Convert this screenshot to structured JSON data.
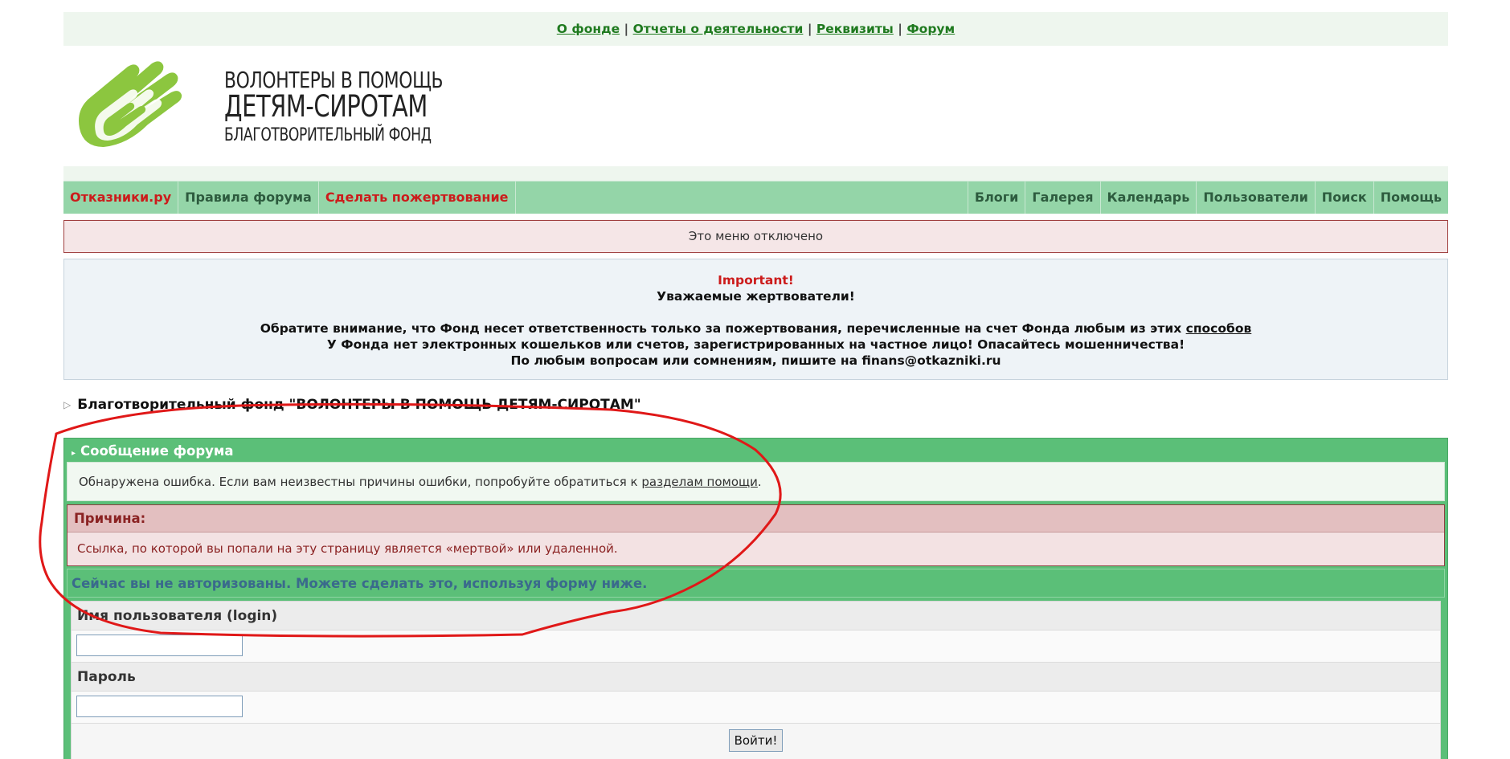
{
  "toplinks": {
    "items": [
      "О фонде",
      "Отчеты о деятельности",
      "Реквизиты",
      "Форум"
    ],
    "separator": "|"
  },
  "logo": {
    "line1": "ВОЛОНТЕРЫ В ПОМОЩЬ",
    "line2": "ДЕТЯМ-СИРОТАМ",
    "line3": "БЛАГОТВОРИТЕЛЬНЫЙ ФОНД"
  },
  "nav": {
    "left": [
      {
        "label": "Отказники.ру",
        "color": "#cc1b1b"
      },
      {
        "label": "Правила форума",
        "color": "#2d5b3e"
      },
      {
        "label": "Сделать пожертвование",
        "color": "#cc1b1b"
      }
    ],
    "right": [
      "Блоги",
      "Галерея",
      "Календарь",
      "Пользователи",
      "Поиск",
      "Помощь"
    ]
  },
  "disabled_menu": "Это меню отключено",
  "notice": {
    "important": "Important!",
    "greeting": "Уважаемые жертвователи!",
    "line1_prefix": "Обратите внимание, что Фонд несет ответственность только за пожертвования, перечисленные на счет Фонда любым из этих",
    "line1_link": "способов",
    "line2": "У Фонда нет электронных кошельков или счетов, зарегистрированных на частное лицо! Опасайтесь мошенничества!",
    "line3": "По любым вопросам или сомнениям, пишите на finans@otkazniki.ru"
  },
  "breadcrumb": "Благотворительный фонд \"ВОЛОНТЕРЫ В ПОМОЩЬ ДЕТЯМ-СИРОТАМ\"",
  "message": {
    "title": "Сообщение форума",
    "body_prefix": "Обнаружена ошибка. Если вам неизвестны причины ошибки, попробуйте обратиться к",
    "body_link": "разделам помощи",
    "body_suffix": ".",
    "reason_title": "Причина:",
    "reason_text": "Ссылка, по которой вы попали на эту страницу является «мертвой» или удаленной.",
    "login_note": "Сейчас вы не авторизованы. Можете сделать это, используя форму ниже."
  },
  "form": {
    "username_label": "Имя пользователя (login)",
    "username_value": "",
    "password_label": "Пароль",
    "password_value": "",
    "submit_label": "Войти!"
  },
  "colors": {
    "accent_green": "#5bbf78",
    "nav_green": "#94d5a8",
    "alert_red": "#cc1b1b",
    "annotation_red": "#e01818"
  }
}
